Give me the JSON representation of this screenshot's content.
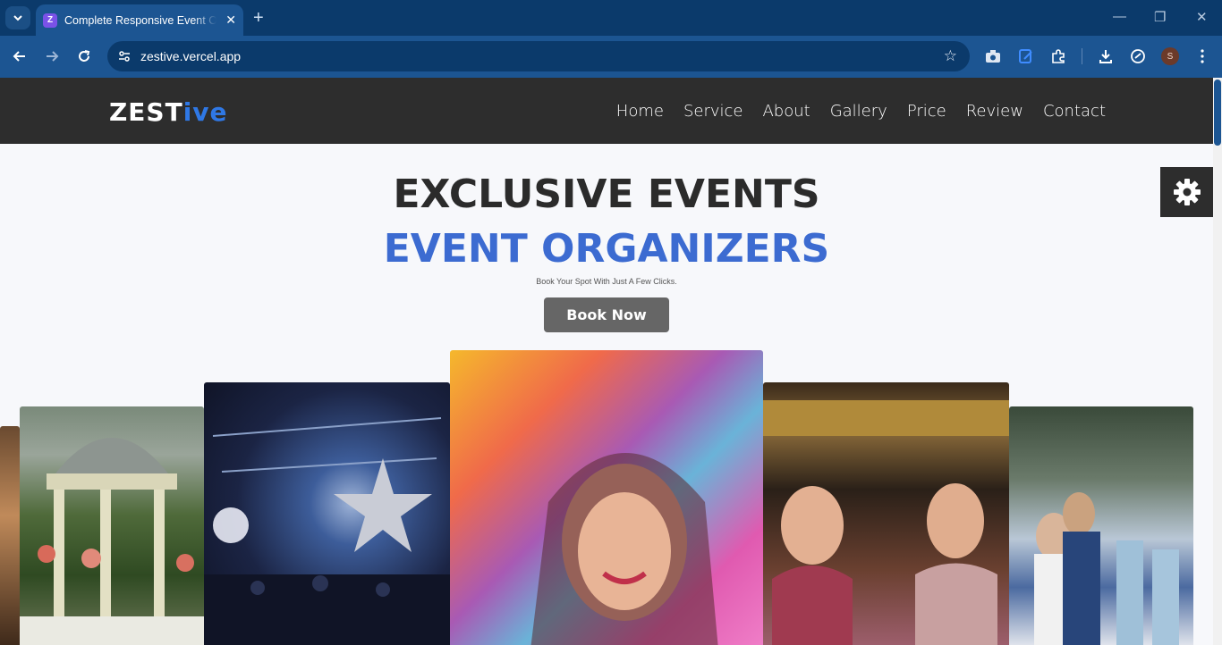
{
  "browser": {
    "tab_title": "Complete Responsive Event Organizer",
    "favicon_letter": "Z",
    "url": "zestive.vercel.app",
    "profile_initial": "S"
  },
  "site": {
    "logo_main": "ZEST",
    "logo_accent": "ive",
    "nav": [
      "Home",
      "Service",
      "About",
      "Gallery",
      "Price",
      "Review",
      "Contact"
    ]
  },
  "hero": {
    "title_line1": "EXCLUSIVE EVENTS",
    "title_line2": "EVENT ORGANIZERS",
    "tagline": "Book Your Spot With Just A Few Clicks.",
    "cta_label": "Book Now"
  },
  "colors": {
    "accent": "#3c6bd1",
    "header_bg": "#2d2d2d",
    "chrome_bg": "#0b3a6b"
  },
  "icons": [
    "chevron-down-icon",
    "close-icon",
    "plus-icon",
    "minimize-icon",
    "restore-icon",
    "back-icon",
    "forward-icon",
    "reload-icon",
    "site-info-icon",
    "star-icon",
    "camera-icon",
    "edit-icon",
    "puzzle-icon",
    "download-icon",
    "refresh-circle-icon",
    "more-icon",
    "gear-icon"
  ]
}
